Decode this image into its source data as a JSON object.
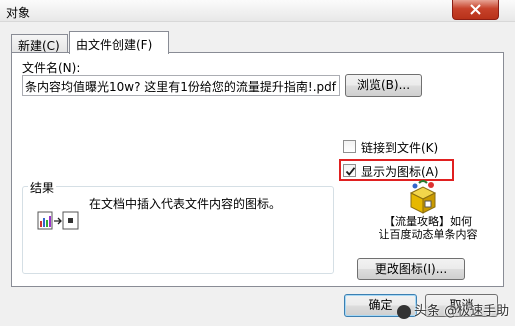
{
  "window": {
    "title": "对象",
    "close_glyph": "✕"
  },
  "tabs": [
    {
      "label": "新建(C)"
    },
    {
      "label": "由文件创建(F)"
    }
  ],
  "file": {
    "label": "文件名(N):",
    "value": "条内容均值曝光10w? 这里有1份给您的流量提升指南!.pdf",
    "browse_label": "浏览(B)..."
  },
  "options": {
    "link_label": "链接到文件(K)",
    "link_checked": false,
    "display_icon_label": "显示为图标(A)",
    "display_icon_checked": true
  },
  "result": {
    "legend": "结果",
    "text": "在文档中插入代表文件内容的图标。"
  },
  "icon_caption": {
    "line1": "【流量攻略】如何",
    "line2": "让百度动态单条内容"
  },
  "buttons": {
    "change_icon": "更改图标(I)...",
    "ok": "确定",
    "cancel": "取消"
  },
  "watermark": {
    "text": "头条 @极速手助"
  },
  "colors": {
    "highlight": "#e02020",
    "accent": "#3c7fb1"
  }
}
